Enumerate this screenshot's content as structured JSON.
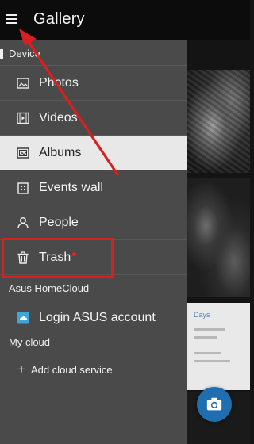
{
  "app_bar": {
    "title": "Gallery",
    "menu_icon": "hamburger-menu-icon"
  },
  "drawer": {
    "sections": {
      "device": "Device",
      "asus_homecloud": "Asus HomeCloud",
      "my_cloud": "My cloud"
    },
    "items": [
      {
        "label": "Photos",
        "icon": "photo-icon"
      },
      {
        "label": "Videos",
        "icon": "video-icon"
      },
      {
        "label": "Albums",
        "icon": "album-icon",
        "selected": true
      },
      {
        "label": "Events wall",
        "icon": "calendar-icon"
      },
      {
        "label": "People",
        "icon": "person-icon"
      },
      {
        "label": "Trash",
        "icon": "trash-icon",
        "badge": true
      }
    ],
    "homecloud_item": {
      "label": "Login ASUS account",
      "icon": "cloud-icon"
    },
    "my_cloud_item": {
      "label": "Add cloud service",
      "icon": "plus-icon"
    }
  },
  "background_content": {
    "thumb_text": "Days"
  },
  "fab": {
    "icon": "camera-icon"
  },
  "colors": {
    "app_bar": "#0c0c0c",
    "drawer": "#4a4a4a",
    "selected_row": "#e8e8e8",
    "highlight": "#d82020",
    "fab": "#1f6fb0",
    "cloud_icon": "#3ea7d8"
  },
  "annotation": {
    "highlight_box_target": "Trash",
    "arrow_target": "hamburger-menu-icon"
  }
}
